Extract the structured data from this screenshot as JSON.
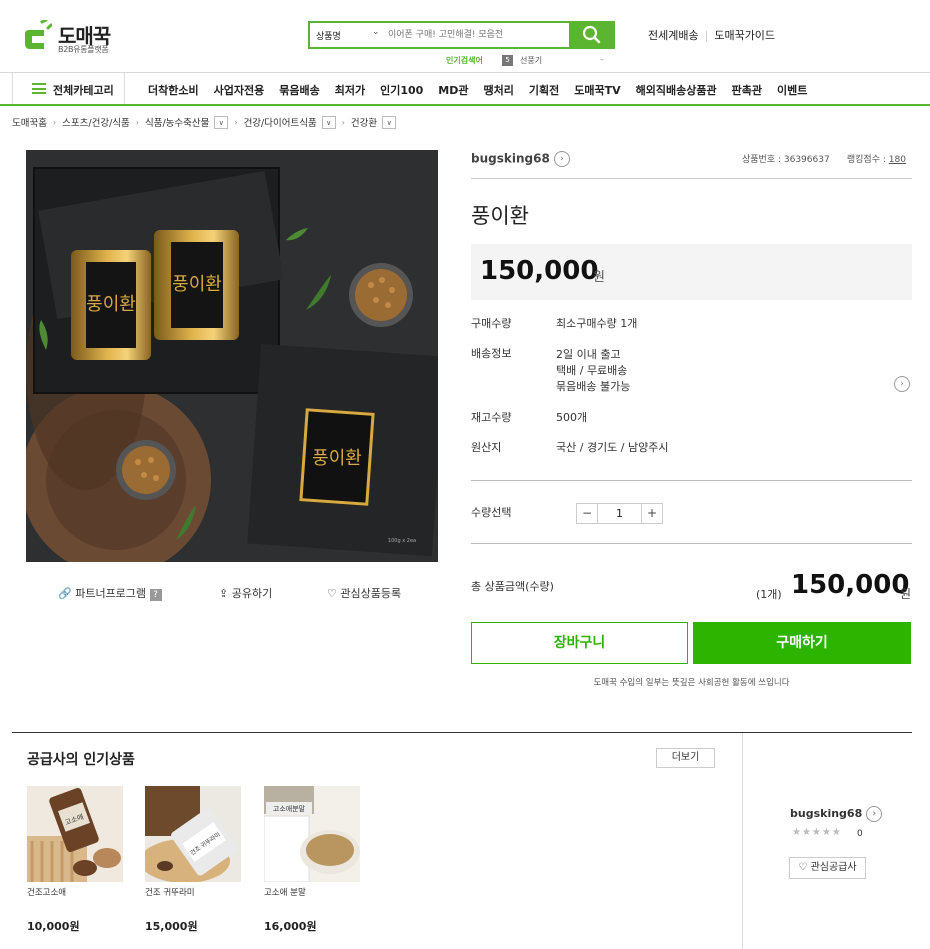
{
  "header": {
    "logo_brand": "도매꾹",
    "logo_sub": "B2B유통플랫폼",
    "search_category": "상품명",
    "search_placeholder": "이어폰 구매! 고민해결! 모음전",
    "popular_label": "인기검색어",
    "popular_rank": "5",
    "popular_keyword": "선풍기",
    "popular_change": "–",
    "top_links": [
      "전세계배송",
      "도매꾹가이드"
    ]
  },
  "nav": {
    "category_label": "전체카테고리",
    "items": [
      "더착한소비",
      "사업자전용",
      "묶음배송",
      "최저가",
      "인기100",
      "MD관",
      "땡처리",
      "기획전",
      "도매꾹TV",
      "해외직배송상품관",
      "판촉관",
      "이벤트"
    ]
  },
  "breadcrumb": [
    "도매꾹홈",
    "스포츠/건강/식품",
    "식품/농수축산물",
    "건강/다이어트식품",
    "건강환"
  ],
  "product": {
    "seller": "bugsking68",
    "number_label": "상품번호 : 36396637",
    "ranking_label": "랭킹점수 :",
    "ranking_value": "180",
    "name": "풍이환",
    "price": "150,000",
    "won": "원",
    "image_text": {
      "box_label": "풍이환",
      "box_size": "100g x 2ea"
    },
    "info": [
      {
        "key": "구매수량",
        "lines": [
          "최소구매수량 1개"
        ]
      },
      {
        "key": "배송정보",
        "lines": [
          "2일 이내 출고",
          "택배 / 무료배송",
          "묶음배송 불가능"
        ]
      },
      {
        "key": "재고수량",
        "lines": [
          "500개"
        ]
      },
      {
        "key": "원산지",
        "lines": [
          "국산 / 경기도 / 남양주시"
        ]
      }
    ],
    "qty_label": "수량선택",
    "qty_minus": "−",
    "qty_plus": "+",
    "qty_value": "1",
    "total_label": "총 상품금액(수량)",
    "total_count": "(1개)",
    "total_value": "150,000",
    "cart_label": "장바구니",
    "buy_label": "구매하기",
    "notice": "도매꾹 수입의 일부는 뜻깊은 사회공헌 활동에 쓰입니다",
    "actions": [
      "파트너프로그램",
      "공유하기",
      "관심상품등록"
    ]
  },
  "supplier": {
    "title": "공급사의 인기상품",
    "more_label": "더보기",
    "products": [
      {
        "name": "건조고소애",
        "price": "10,000원"
      },
      {
        "name": "건조 귀뚜라미",
        "price": "15,000원"
      },
      {
        "name": "고소애 분말",
        "price": "16,000원"
      }
    ],
    "thumb_text": [
      "고소애",
      "건조 귀뚜라미",
      "고소애분말"
    ],
    "seller_name": "bugsking68",
    "stars": "★★★★★",
    "rating_count": "0",
    "fav_label": "관심공급사"
  },
  "colors": {
    "accent": "#5cb531",
    "buy": "#2db400"
  }
}
